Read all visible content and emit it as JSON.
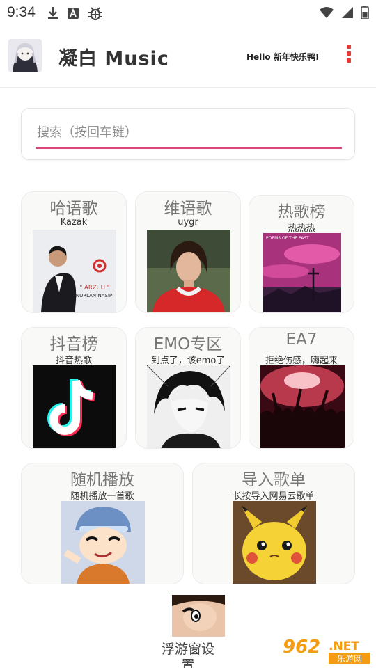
{
  "status_bar": {
    "time": "9:34",
    "left_icons": [
      "download-icon",
      "a-badge-icon",
      "bug-icon"
    ],
    "right_icons": [
      "wifi-icon",
      "signal-icon",
      "battery-icon"
    ]
  },
  "header": {
    "title": "凝白 Music",
    "greeting": "Hello 新年快乐鸭!",
    "menu_icon": "more-vert-icon",
    "accent_color": "#e53935"
  },
  "search": {
    "placeholder": "搜索（按回车键）",
    "value": "",
    "underline_color": "#d9487a"
  },
  "cards": [
    {
      "title": "哈语歌",
      "subtitle": "Kazak",
      "image": "kazak-album-cover",
      "cover_text": "\" ARZUU \"",
      "cover_sub": "NURLAN NASIP"
    },
    {
      "title": "维语歌",
      "subtitle": "uygr",
      "image": "uygur-singer-photo"
    },
    {
      "title": "热歌榜",
      "subtitle": "热热热",
      "image": "pink-sky-album-cover",
      "cover_text": "POEMS OF THE PAST"
    },
    {
      "title": "抖音榜",
      "subtitle": "抖音热歌",
      "image": "tiktok-logo"
    },
    {
      "title": "EMO专区",
      "subtitle": "到点了，该emo了",
      "image": "manga-boy-art"
    },
    {
      "title": "EA7",
      "subtitle": "拒绝伤感，嗨起来",
      "image": "concert-crowd-photo"
    },
    {
      "title": "随机播放",
      "subtitle": "随机播放一首歌",
      "image": "crayon-shin-chan"
    },
    {
      "title": "导入歌单",
      "subtitle": "长按导入网易云歌单",
      "image": "pikachu-photo"
    }
  ],
  "floating_window": {
    "label": "浮游窗设置",
    "image": "shin-chan-face"
  },
  "watermark": {
    "brand": "962",
    "tld": ".NET",
    "site": "乐游网"
  }
}
